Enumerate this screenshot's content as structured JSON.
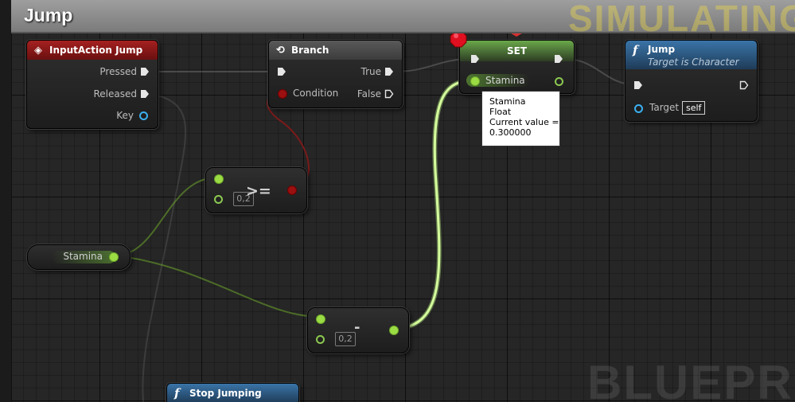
{
  "graph": {
    "title": "Jump",
    "simulating_label": "SIMULATING",
    "watermark": "BLUEPRINT"
  },
  "nodes": {
    "input_action": {
      "title": "InputAction Jump",
      "pins": {
        "pressed": "Pressed",
        "released": "Released",
        "key": "Key"
      }
    },
    "branch": {
      "title": "Branch",
      "pins": {
        "condition": "Condition",
        "true": "True",
        "false": "False"
      }
    },
    "set": {
      "title": "SET",
      "pins": {
        "stamina": "Stamina"
      }
    },
    "jump": {
      "title": "Jump",
      "subtitle": "Target is Character",
      "pins": {
        "target": "Target",
        "self": "self"
      }
    },
    "compare": {
      "operator": ">=",
      "value": "0,2"
    },
    "subtract": {
      "operator": "-",
      "value": "0,2"
    },
    "stamina_get": {
      "label": "Stamina"
    },
    "stop_jumping": {
      "title": "Stop Jumping"
    }
  },
  "tooltip": {
    "name": "Stamina",
    "type": "Float",
    "value_label": "Current value =",
    "value": "0.300000"
  },
  "colors": {
    "event_header": "#8b1a1a",
    "flow_header": "#4a4a4a",
    "function_header": "#2f5d85",
    "float_pin": "#9bdc44",
    "bool_pin": "#9b1010",
    "struct_pin": "#3ab0f0",
    "breakpoint": "#e01020"
  },
  "icons": {
    "event": "diamond-event-icon",
    "branch": "branch-arrow-icon",
    "function": "function-f-icon",
    "breakpoint": "breakpoint-octagon-icon"
  }
}
